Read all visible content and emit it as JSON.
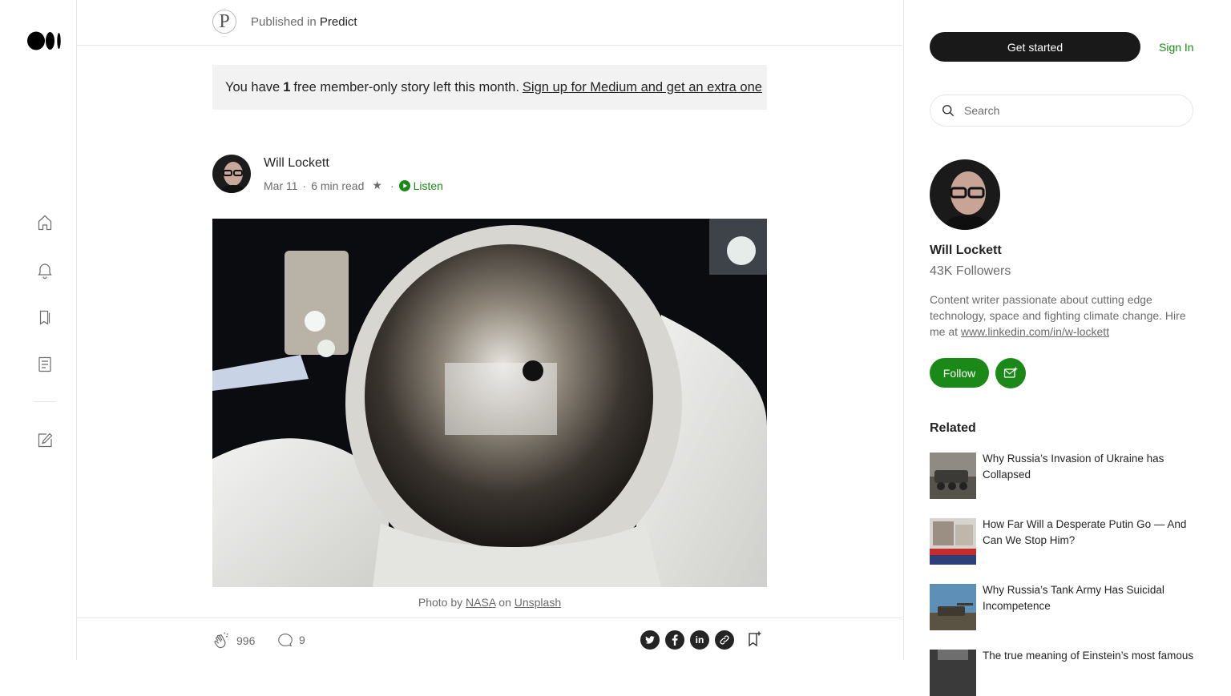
{
  "sidebar": {
    "items": [
      {
        "name": "home-icon"
      },
      {
        "name": "notifications-icon"
      },
      {
        "name": "bookmarks-icon"
      },
      {
        "name": "stories-icon"
      },
      {
        "name": "write-icon"
      }
    ]
  },
  "publication": {
    "prefix": "Published in",
    "name": "Predict",
    "logo_letter": "P"
  },
  "banner": {
    "text_before": "You have",
    "count": "1",
    "text_after": "free member-only story left this month.",
    "link": "Sign up for Medium and get an extra one"
  },
  "author": {
    "name": "Will Lockett",
    "date": "Mar 11",
    "read_time": "6 min read",
    "star": "★",
    "dot": "·",
    "listen": "Listen"
  },
  "caption": {
    "prefix": "Photo by",
    "credit": "NASA",
    "middle": "on",
    "source": "Unsplash"
  },
  "actions": {
    "claps": "996",
    "responses": "9"
  },
  "right": {
    "get_started": "Get started",
    "sign_in": "Sign In",
    "search_placeholder": "Search",
    "profile": {
      "name": "Will Lockett",
      "followers": "43K Followers",
      "bio": "Content writer passionate about cutting edge technology, space and fighting climate change. Hire me at",
      "link": "www.linkedin.com/in/w-lockett",
      "follow": "Follow"
    },
    "related_heading": "Related",
    "related": [
      {
        "title": "Why Russia’s Invasion of Ukraine has Collapsed"
      },
      {
        "title": "How Far Will a Desperate Putin Go — And Can We Stop Him?"
      },
      {
        "title": "Why Russia’s Tank Army Has Suicidal Incompetence"
      },
      {
        "title": "The true meaning of Einstein’s most famous"
      }
    ]
  },
  "colors": {
    "accent_green": "#1a8917",
    "text": "#242424",
    "muted": "#6b6b6b",
    "border": "#e6e6e6"
  }
}
